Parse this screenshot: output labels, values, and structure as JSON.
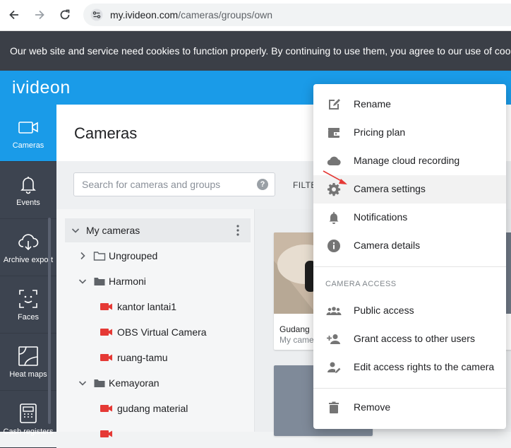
{
  "browser": {
    "url_host": "my.ivideon.com",
    "url_path": "/cameras/groups/own"
  },
  "cookie_banner": {
    "text": "Our web site and service need cookies to function properly. By continuing to use them, you agree to our use of cook"
  },
  "app": {
    "logo": "ivideon",
    "page_title": "Cameras"
  },
  "left_nav": {
    "items": [
      {
        "label": "Cameras",
        "icon": "video-camera-icon",
        "active": true
      },
      {
        "label": "Events",
        "icon": "bell-icon"
      },
      {
        "label": "Archive export",
        "icon": "cloud-download-icon"
      },
      {
        "label": "Faces",
        "icon": "face-scan-icon"
      },
      {
        "label": "Heat maps",
        "icon": "heat-map-icon"
      },
      {
        "label": "Cash registers",
        "icon": "cash-register-icon"
      }
    ]
  },
  "search": {
    "placeholder": "Search for cameras and groups",
    "help": "?",
    "filter_label": "FILTE"
  },
  "tree": {
    "root": "My cameras",
    "groups": [
      {
        "name": "Ungrouped",
        "expanded": false
      },
      {
        "name": "Harmoni",
        "expanded": true,
        "cameras": [
          "kantor lantai1",
          "OBS Virtual Camera",
          "ruang-tamu"
        ]
      },
      {
        "name": "Kemayoran",
        "expanded": true,
        "cameras": [
          "gudang material"
        ]
      }
    ]
  },
  "cards": [
    {
      "title": "Gudang",
      "subtitle": "My came"
    }
  ],
  "context_menu": {
    "items": [
      {
        "label": "Rename",
        "icon": "edit-icon"
      },
      {
        "label": "Pricing plan",
        "icon": "wallet-icon"
      },
      {
        "label": "Manage cloud recording",
        "icon": "cloud-icon"
      },
      {
        "label": "Camera settings",
        "icon": "gear-icon",
        "highlighted": true
      },
      {
        "label": "Notifications",
        "icon": "bell-icon"
      },
      {
        "label": "Camera details",
        "icon": "info-icon"
      }
    ],
    "section_heading": "CAMERA ACCESS",
    "access_items": [
      {
        "label": "Public access",
        "icon": "group-icon"
      },
      {
        "label": "Grant access to other users",
        "icon": "person-add-icon"
      },
      {
        "label": "Edit access rights to the camera",
        "icon": "person-edit-icon"
      }
    ],
    "remove_label": "Remove",
    "remove_icon": "trash-icon"
  },
  "colors": {
    "brand_blue": "#1a9be8",
    "nav_dark": "#3d4450",
    "camera_red": "#e53935",
    "annotation_arrow": "#e53935"
  }
}
